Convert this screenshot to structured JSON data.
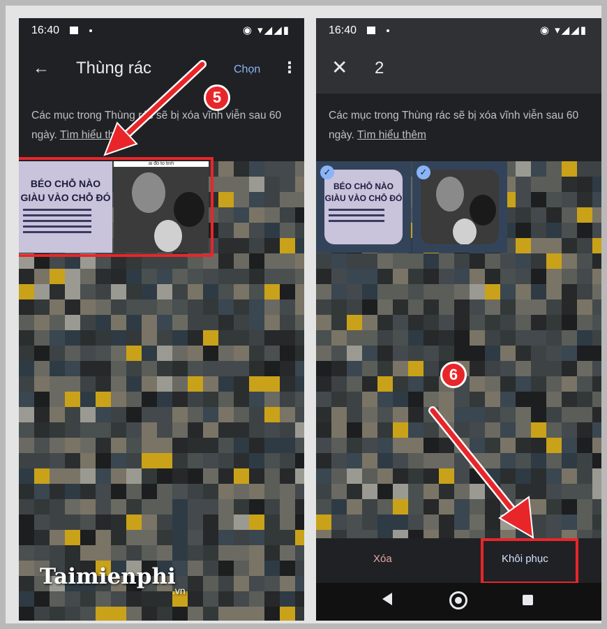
{
  "left_screen": {
    "status_time": "16:40",
    "title": "Thùng rác",
    "select_label": "Chọn",
    "info_text": "Các mục trong Thùng rác sẽ bị xóa vĩnh viễn sau 60 ngày.",
    "learn_more": "Tìm hiểu thêm",
    "step_number": "5",
    "poster_text": "BÉO CHỖ NÀO GIÀU VÀO CHỖ ĐÓ",
    "movie_strip_text": "ai đó to tinh"
  },
  "right_screen": {
    "status_time": "16:40",
    "selected_count": "2",
    "info_text": "Các mục trong Thùng rác sẽ bị xóa vĩnh viễn sau 60 ngày.",
    "learn_more": "Tìm hiểu thêm",
    "step_number": "6",
    "poster_text": "BÉO CHỖ NÀO GIÀU VÀO CHỖ ĐÓ",
    "delete_label": "Xóa",
    "restore_label": "Khôi phục"
  },
  "watermark": {
    "brand": "Taimienphi",
    "suffix": ".vn"
  },
  "colors": {
    "accent_blue": "#8ab4f8",
    "highlight_red": "#e8262a",
    "background_dark": "#202124"
  }
}
